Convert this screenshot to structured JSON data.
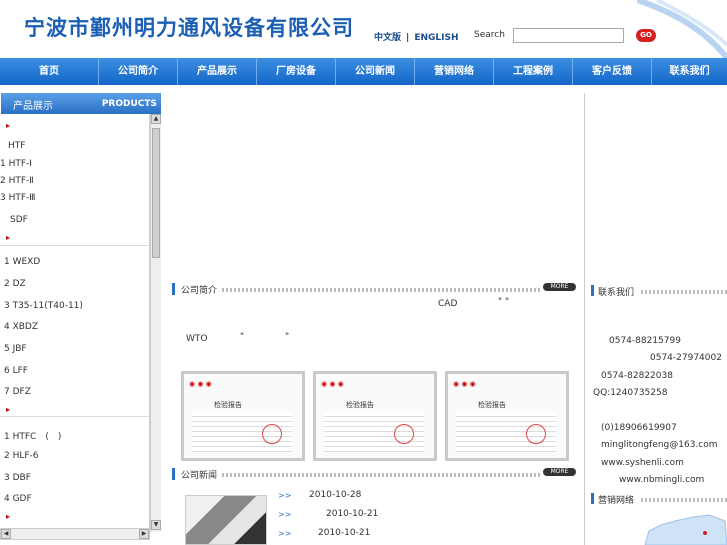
{
  "header": {
    "logo_text": "宁波市鄞州明力通风设备有限公司",
    "lang_cn": "中文版",
    "lang_sep": "|",
    "lang_en": "ENGLISH",
    "search_label": "Search",
    "search_value": "",
    "go_label": "GO"
  },
  "nav": {
    "items": [
      "首页",
      "公司简介",
      "产品展示",
      "厂房设备",
      "公司新闻",
      "营销网络",
      "工程案例",
      "客户反馈",
      "联系我们"
    ]
  },
  "sidebar": {
    "title_cn": "产品展示",
    "title_en": "PRODUCTS",
    "items": [
      "HTF",
      "1 HTF-I",
      "2 HTF-Ⅱ",
      "3 HTF-Ⅲ",
      "SDF",
      "1 WEXD",
      "2 DZ",
      "3 T35-11(T40-11)",
      "4 XBDZ",
      "5 JBF",
      "6 LFF",
      "7 DFZ",
      "1 HTFC　(　)",
      "2 HLF-6",
      "3 DBF",
      "4 GDF"
    ],
    "scroll_up": "▲",
    "scroll_down": "▼",
    "scroll_left": "◀",
    "scroll_right": "▶"
  },
  "intro": {
    "title": "公司简介",
    "more": "MORE",
    "cad": "CAD",
    "quote": "\" \"",
    "wto": "WTO",
    "q1": "\"",
    "q2": "\""
  },
  "certs": {
    "title": "检验报告",
    "logos": "◉ ◉ ◉"
  },
  "news": {
    "title": "公司新闻",
    "more": "MORE",
    "bullet": ">>",
    "dates": [
      "2010-10-28",
      "2010-10-21",
      "2010-10-21"
    ]
  },
  "contact": {
    "title": "联系我们",
    "lines": [
      "0574-88215799",
      "0574-27974002",
      "0574-82822038",
      "QQ:1240735258",
      "(0)18906619907",
      "minglitongfeng@163.com",
      "www.syshenli.com",
      "www.nbmingli.com"
    ]
  },
  "network": {
    "title": "营销网络"
  },
  "colors": {
    "nav_blue": "#1466c8",
    "logo_blue": "#1a5fb4",
    "accent_red": "#d62020"
  }
}
